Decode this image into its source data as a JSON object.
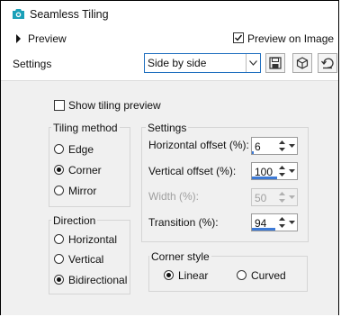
{
  "window": {
    "title": "Seamless Tiling"
  },
  "preview": {
    "label": "Preview",
    "preview_on_image_label": "Preview on Image",
    "preview_on_image_checked": true
  },
  "settings_row": {
    "label": "Settings",
    "preset_value": "Side by side"
  },
  "show_tiling_preview": {
    "label": "Show tiling preview",
    "checked": false
  },
  "tiling_method": {
    "title": "Tiling method",
    "options": [
      {
        "label": "Edge",
        "checked": false
      },
      {
        "label": "Corner",
        "checked": true
      },
      {
        "label": "Mirror",
        "checked": false
      }
    ]
  },
  "direction": {
    "title": "Direction",
    "options": [
      {
        "label": "Horizontal",
        "checked": false
      },
      {
        "label": "Vertical",
        "checked": false
      },
      {
        "label": "Bidirectional",
        "checked": true
      }
    ]
  },
  "settings_group": {
    "title": "Settings",
    "fields": [
      {
        "label": "Horizontal offset (%):",
        "value": "6",
        "fill": 0.06,
        "enabled": true
      },
      {
        "label": "Vertical offset (%):",
        "value": "100",
        "fill": 1.0,
        "enabled": true
      },
      {
        "label": "Width (%):",
        "value": "50",
        "fill": 0.5,
        "enabled": false
      },
      {
        "label": "Transition (%):",
        "value": "94",
        "fill": 0.94,
        "enabled": true
      }
    ]
  },
  "corner_style": {
    "title": "Corner style",
    "options": [
      {
        "label": "Linear",
        "checked": true
      },
      {
        "label": "Curved",
        "checked": false
      }
    ]
  },
  "colors": {
    "accent": "#3d7ad6",
    "app_icon": "#1aa0b8"
  },
  "icons": [
    "app-icon",
    "expand-arrow-icon",
    "checkmark-icon",
    "dropdown-arrow-icon",
    "save-icon",
    "cube-icon",
    "reset-icon",
    "spin-updown-icon"
  ]
}
